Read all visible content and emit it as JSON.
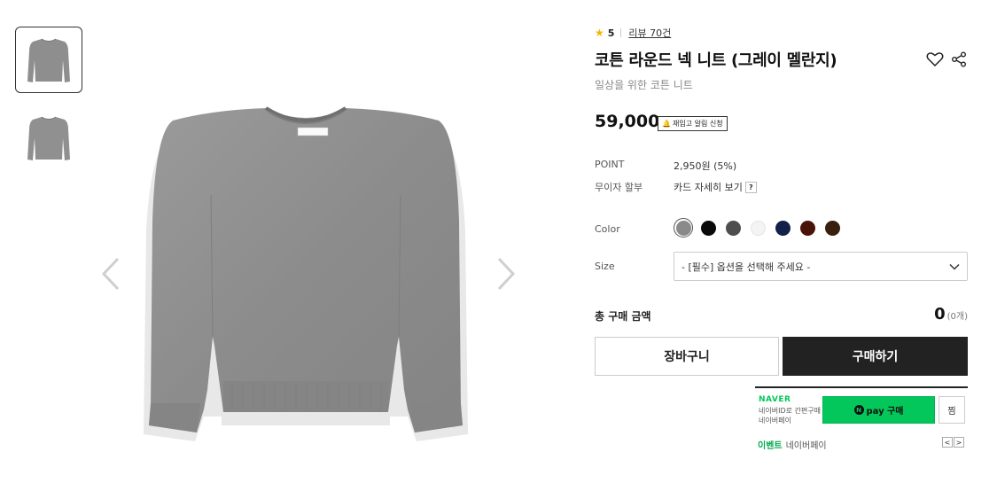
{
  "colors": {
    "naver_green": "#03c75a",
    "buy_button": "#222222",
    "star": "#f5b400",
    "sweater": "#8e8e8e"
  },
  "gallery": {
    "thumbnails": [
      {
        "icon": "sweater-thumbnail-icon",
        "active": true
      },
      {
        "icon": "sweater-thumbnail-icon",
        "active": false
      }
    ],
    "prev_icon": "chevron-left-icon",
    "next_icon": "chevron-right-icon",
    "main_image": "gray-round-neck-sweater"
  },
  "product": {
    "rating": "5",
    "review": "리뷰 70건",
    "title": "코튼 라운드 넥 니트 (그레이 멜란지)",
    "subtitle": "일상을 위한 코튼 니트",
    "price": "59,000",
    "restock_label": "재입고 알림 신청",
    "point_label": "POINT",
    "point_value": "2,950원 (5%)",
    "installment_label": "무이자 할부",
    "installment_value": "카드 자세히 보기",
    "installment_help": "?",
    "color_label": "Color",
    "colors": [
      {
        "name": "gray",
        "hex": "#8a8a8a",
        "selected": true
      },
      {
        "name": "black",
        "hex": "#0a0a0a",
        "selected": false
      },
      {
        "name": "charcoal",
        "hex": "#4e4e4e",
        "selected": false
      },
      {
        "name": "white",
        "hex": "#f4f4f4",
        "selected": false
      },
      {
        "name": "navy",
        "hex": "#13204a",
        "selected": false
      },
      {
        "name": "burgundy",
        "hex": "#4a1208",
        "selected": false
      },
      {
        "name": "brown",
        "hex": "#3a1e0e",
        "selected": false
      }
    ],
    "size_label": "Size",
    "size_placeholder": "- [필수] 옵션을 선택해 주세요 -",
    "total_label": "총 구매 금액",
    "total_value": "0",
    "total_count": "(0개)",
    "cart_button": "장바구니",
    "buy_button": "구매하기"
  },
  "naverpay": {
    "logo": "NAVER",
    "desc_line1": "네이버ID로 간편구매",
    "desc_line2": "네이버페이",
    "button_icon": "N",
    "button_label": "pay 구매",
    "wish_label": "찜",
    "event_label": "이벤트",
    "event_text": "네이버페이",
    "event_prev": "<",
    "event_next": ">"
  }
}
